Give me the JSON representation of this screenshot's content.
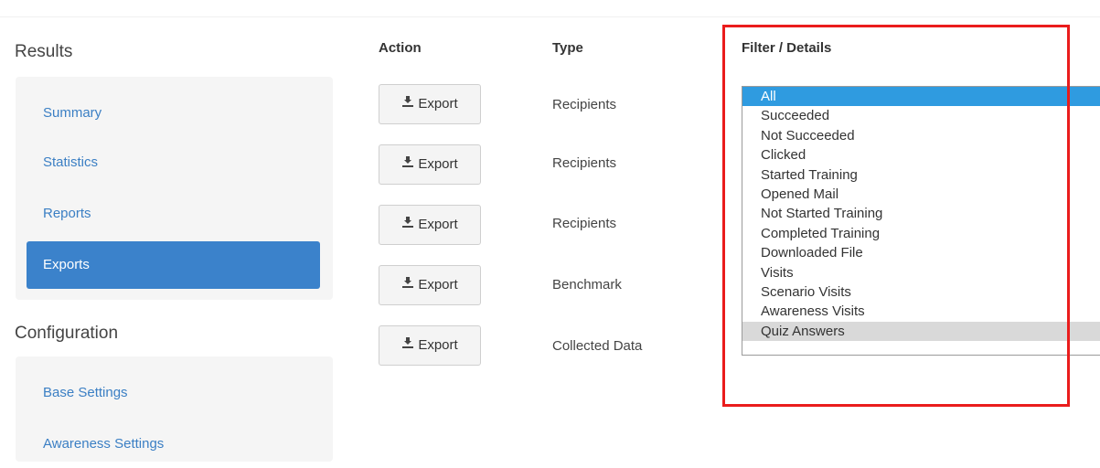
{
  "sidebar": {
    "results_heading": "Results",
    "results_items": [
      {
        "label": "Summary",
        "active": false
      },
      {
        "label": "Statistics",
        "active": false
      },
      {
        "label": "Reports",
        "active": false
      },
      {
        "label": "Exports",
        "active": true
      }
    ],
    "configuration_heading": "Configuration",
    "configuration_items": [
      {
        "label": "Base Settings"
      },
      {
        "label": "Awareness Settings"
      }
    ]
  },
  "table": {
    "headers": {
      "action": "Action",
      "type": "Type",
      "filter": "Filter / Details"
    },
    "rows": [
      {
        "action_label": "Export",
        "type": "Recipients"
      },
      {
        "action_label": "Export",
        "type": "Recipients"
      },
      {
        "action_label": "Export",
        "type": "Recipients"
      },
      {
        "action_label": "Export",
        "type": "Benchmark"
      },
      {
        "action_label": "Export",
        "type": "Collected Data"
      }
    ]
  },
  "filter_list": {
    "selected": "All",
    "options": [
      "All",
      "Succeeded",
      "Not Succeeded",
      "Clicked",
      "Started Training",
      "Opened Mail",
      "Not Started Training",
      "Completed Training",
      "Downloaded File",
      "Visits",
      "Scenario Visits",
      "Awareness Visits",
      "Quiz Answers"
    ],
    "focused": "Quiz Answers"
  },
  "icons": {
    "export": "export-icon"
  },
  "colors": {
    "accent": "#3b82cb",
    "link": "#3b7fc4",
    "highlight": "#ea1c1c",
    "selection": "#2f9be0"
  }
}
